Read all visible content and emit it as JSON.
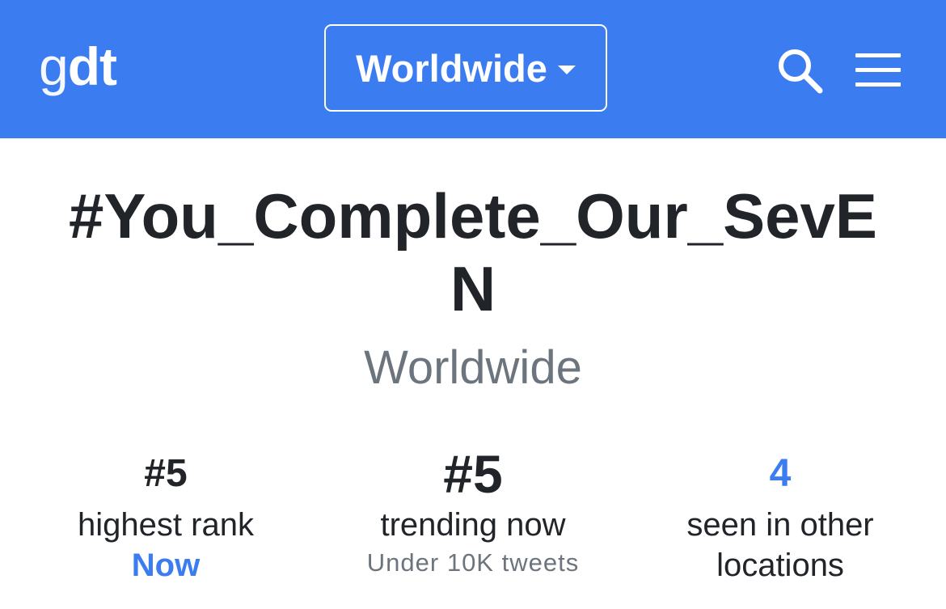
{
  "navbar": {
    "logo_part1": "g",
    "logo_part2": "dt",
    "location_selector": "Worldwide",
    "search_icon": "search-icon",
    "menu_icon": "hamburger-menu-icon",
    "background_color": "#3b7cf0"
  },
  "trend": {
    "hashtag": "#You_Complete_Our_SevEN",
    "location": "Worldwide"
  },
  "stats": {
    "highest_rank": {
      "value": "#5",
      "label": "highest rank",
      "sub": "Now"
    },
    "trending_now": {
      "value": "#5",
      "label": "trending now",
      "sub": "Under 10K tweets"
    },
    "other_locations": {
      "value": "4",
      "label_line1": "seen in other",
      "label_line2": "locations"
    }
  },
  "colors": {
    "accent": "#3b7cf0",
    "text": "#212529",
    "muted": "#6c757d"
  }
}
